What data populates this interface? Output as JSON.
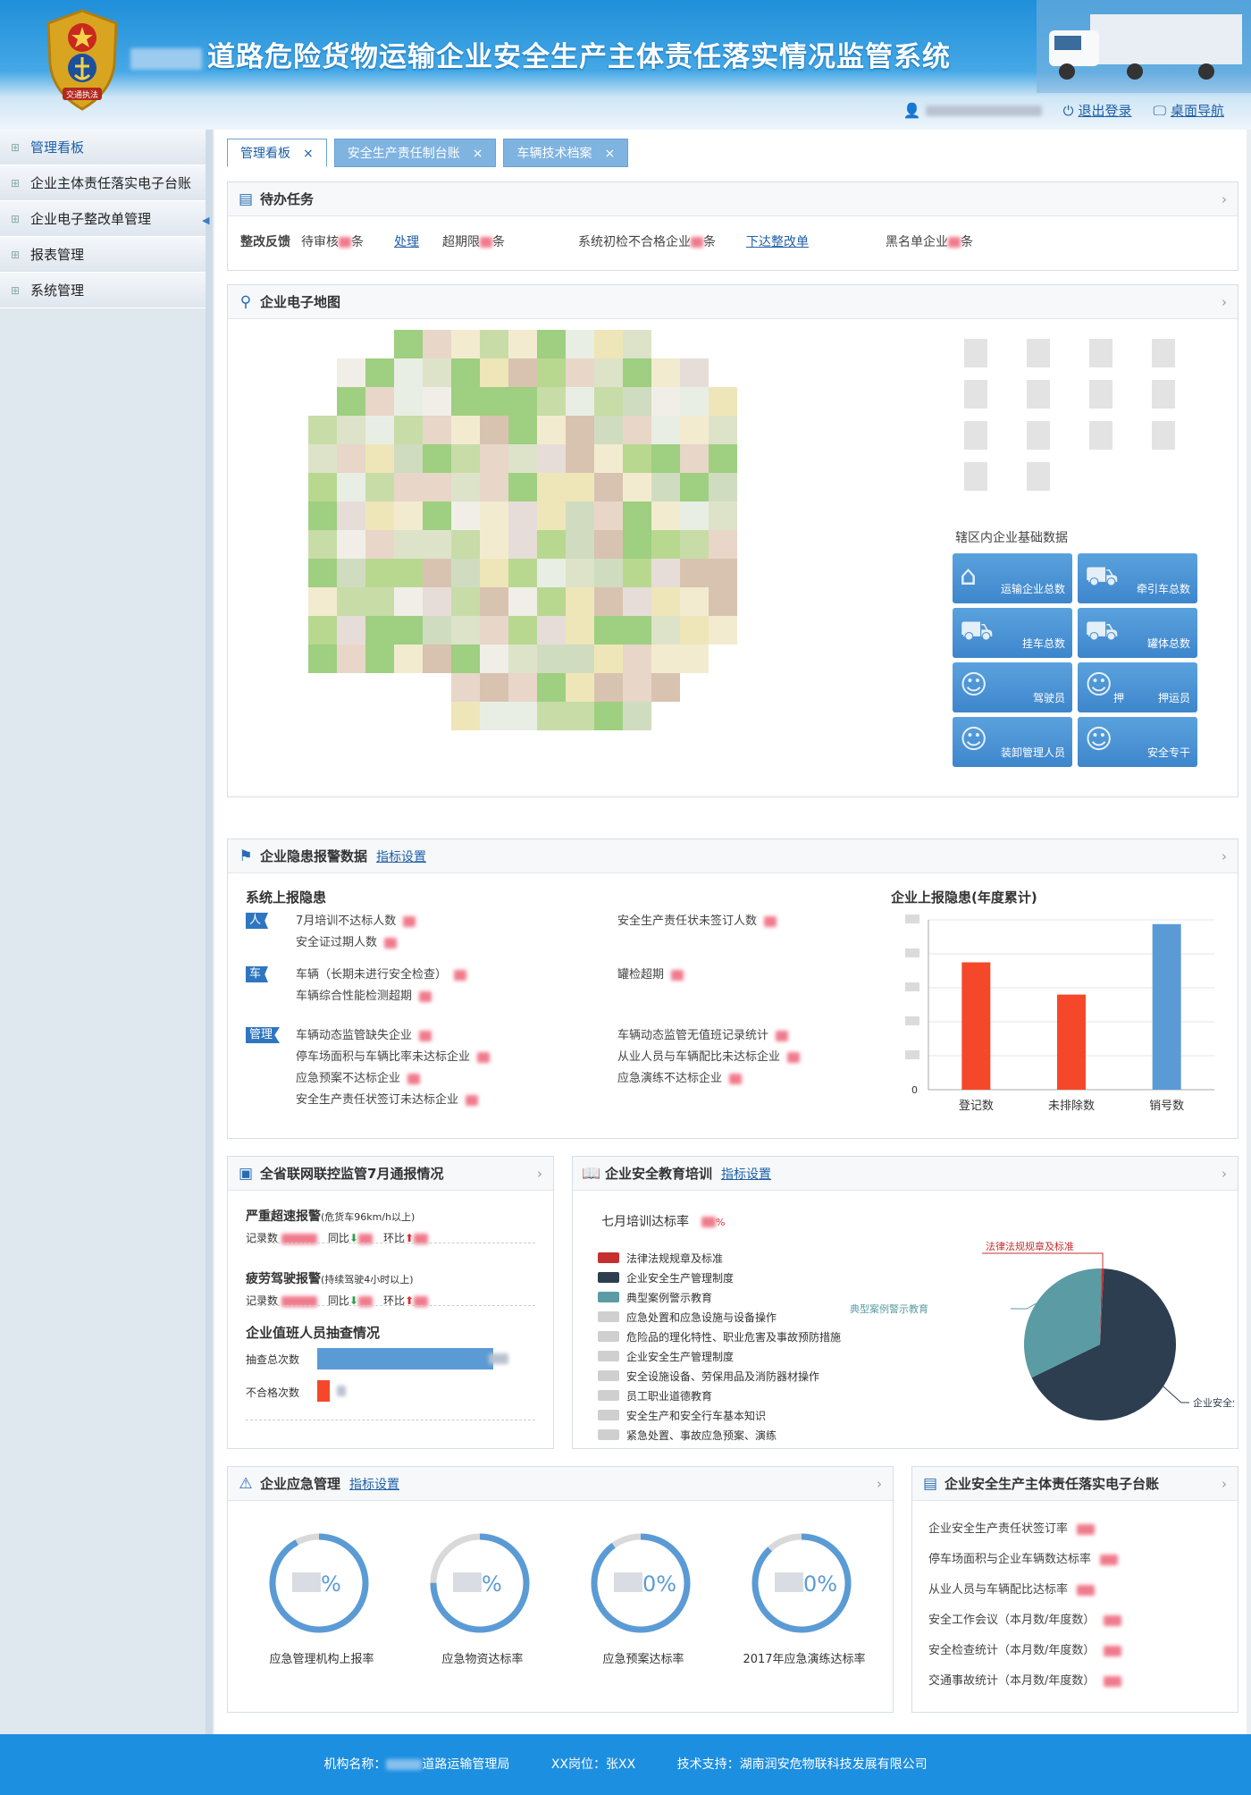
{
  "header": {
    "title": "道路危险货物运输企业安全生产主体责任落实情况监管系统",
    "logo_text": "交通执法",
    "logout": "退出登录",
    "desktop_nav": "桌面导航"
  },
  "sidebar": {
    "items": [
      "管理看板",
      "企业主体责任落实电子台账",
      "企业电子整改单管理",
      "报表管理",
      "系统管理"
    ]
  },
  "tabs": [
    "管理看板",
    "安全生产责任制台账",
    "车辆技术档案"
  ],
  "todo": {
    "title": "待办任务",
    "feedback_label": "整改反馈",
    "pending_review": "待审核",
    "unit": "条",
    "process_link": "处理",
    "overdue": "超期限",
    "initial_fail": "系统初检不合格企业",
    "issue_link": "下达整改单",
    "blacklist": "黑名单企业"
  },
  "map": {
    "title": "企业电子地图",
    "basic_data_title": "辖区内企业基础数据",
    "tiles": [
      "运输企业总数",
      "牵引车总数",
      "挂车总数",
      "罐体总数",
      "驾驶员",
      "押运员",
      "装卸管理人员",
      "安全专干"
    ],
    "tiles_extra": [
      "押"
    ]
  },
  "hazard": {
    "title": "企业隐患报警数据",
    "link": "指标设置",
    "system_title": "系统上报隐患",
    "groups": [
      {
        "tag": "人",
        "left": [
          "7月培训不达标人数",
          "安全证过期人数"
        ],
        "right": [
          "安全生产责任状未签订人数"
        ]
      },
      {
        "tag": "车",
        "left": [
          "车辆（长期未进行安全检查）",
          "车辆综合性能检测超期"
        ],
        "right": [
          "罐检超期"
        ]
      },
      {
        "tag": "管理",
        "left": [
          "车辆动态监管缺失企业",
          "停车场面积与车辆比率未达标企业",
          "应急预案不达标企业",
          "安全生产责任状签订未达标企业"
        ],
        "right": [
          "车辆动态监管无值班记录统计",
          "从业人员与车辆配比未达标企业",
          "应急演练不达标企业"
        ]
      }
    ]
  },
  "chart_data": {
    "type": "bar",
    "title": "企业上报隐患(年度累计)",
    "categories": [
      "登记数",
      "未排除数",
      "销号数"
    ],
    "values": [
      15,
      11.2,
      19.5
    ],
    "colors": [
      "#f5482a",
      "#f5482a",
      "#5b9bd5"
    ],
    "ylim": [
      0,
      20
    ],
    "yticks": [
      "0"
    ],
    "grid": true
  },
  "monitor": {
    "title": "全省联网联控监管7月通报情况",
    "speeding_title": "严重超速报警",
    "speeding_note": "(危货车96km/h以上)",
    "fatigue_title": "疲劳驾驶报警",
    "fatigue_note": "(持续驾驶4小时以上)",
    "records": "记录数",
    "yoy": "同比",
    "mom": "环比",
    "duty_title": "企业值班人员抽查情况",
    "check_total": "抽查总次数",
    "fail_count": "不合格次数",
    "check_total_fraction": 0.82,
    "fail_count_fraction": 0.06
  },
  "training": {
    "title": "企业安全教育培训",
    "link": "指标设置",
    "rate_label": "七月培训达标率",
    "percent": "%",
    "legend": [
      {
        "label": "法律法规规章及标准",
        "color": "#c62f2f"
      },
      {
        "label": "企业安全生产管理制度",
        "color": "#2c3e50"
      },
      {
        "label": "典型案例警示教育",
        "color": "#5b9ba4"
      },
      {
        "label": "应急处置和应急设施与设备操作",
        "color": "#cfcfcf"
      },
      {
        "label": "危险品的理化特性、职业危害及事故预防措施",
        "color": "#cfcfcf"
      },
      {
        "label": "企业安全生产管理制度",
        "color": "#cfcfcf"
      },
      {
        "label": "安全设施设备、劳保用品及消防器材操作",
        "color": "#cfcfcf"
      },
      {
        "label": "员工职业道德教育",
        "color": "#cfcfcf"
      },
      {
        "label": "安全生产和安全行车基本知识",
        "color": "#cfcfcf"
      },
      {
        "label": "紧急处置、事故应急预案、演练",
        "color": "#cfcfcf"
      }
    ],
    "pie": {
      "type": "pie",
      "slices": [
        {
          "label": "法律法规规章及标准",
          "value": 0.5,
          "color": "#c62f2f"
        },
        {
          "label": "企业安全生产管理制度",
          "value": 67,
          "color": "#2c3e50"
        },
        {
          "label": "典型案例警示教育",
          "value": 32.5,
          "color": "#5b9ba4"
        }
      ]
    }
  },
  "emergency": {
    "title": "企业应急管理",
    "link": "指标设置",
    "rings": [
      {
        "label": "应急管理机构上报率",
        "value": 0.92
      },
      {
        "label": "应急物资达标率",
        "value": 0.75
      },
      {
        "label": "应急预案达标率",
        "value": 0.9
      },
      {
        "label": "2017年应急演练达标率",
        "value": 0.88
      }
    ],
    "percent_suffix": "%",
    "ring_texts": [
      "%",
      "%",
      "0%",
      "0%"
    ]
  },
  "ledger": {
    "title": "企业安全生产主体责任落实电子台账",
    "items": [
      "企业安全生产责任状签订率",
      "停车场面积与企业车辆数达标率",
      "从业人员与车辆配比达标率",
      "安全工作会议（本月数/年度数）",
      "安全检查统计（本月数/年度数）",
      "交通事故统计（本月数/年度数）"
    ]
  },
  "footer": {
    "org_label": "机构名称：",
    "org_suffix": "道路运输管理局",
    "post_label": "XX岗位：张XX",
    "support": "技术支持：湖南润安危物联科技发展有限公司"
  }
}
